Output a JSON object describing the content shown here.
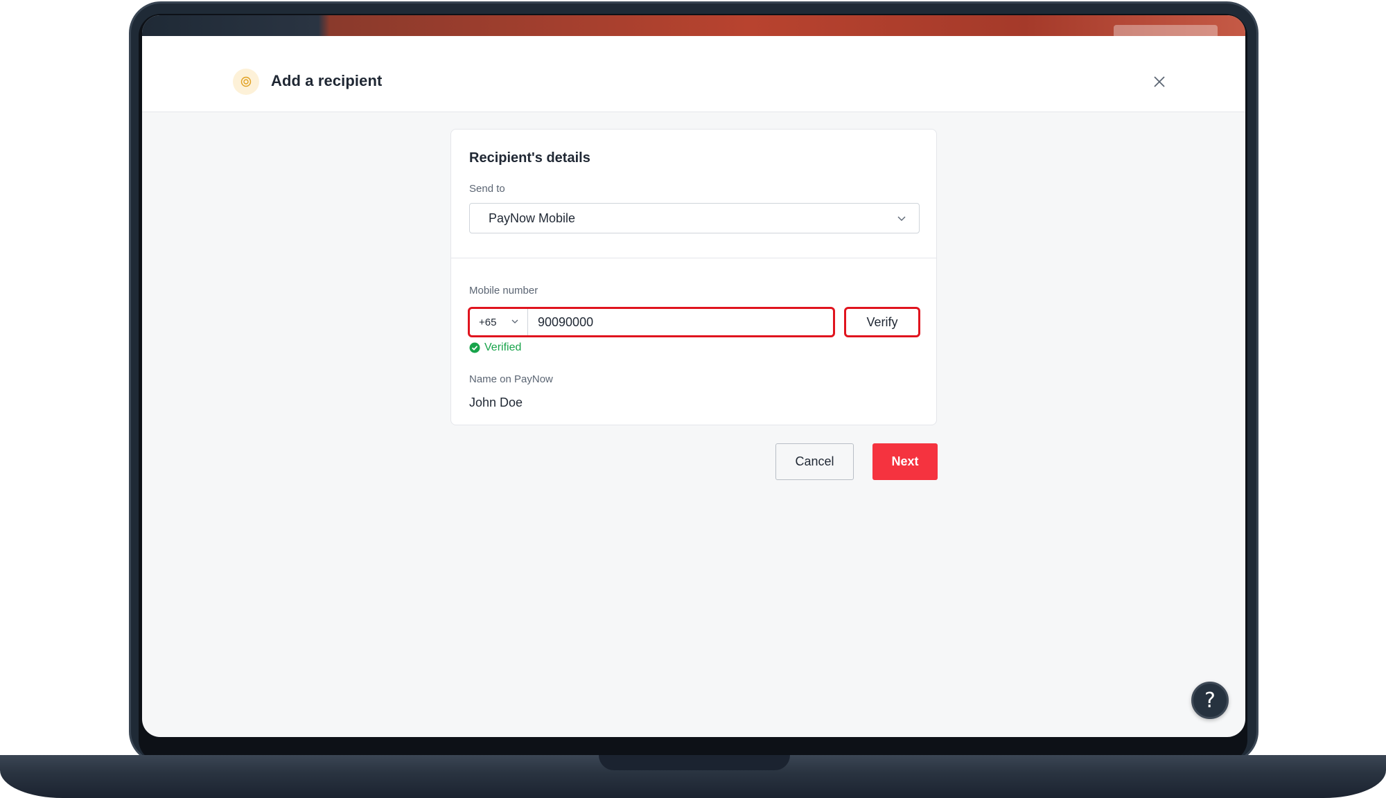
{
  "header": {
    "title": "Add a recipient"
  },
  "card": {
    "section_title": "Recipient's details",
    "send_to": {
      "label": "Send to",
      "selected": "PayNow Mobile"
    },
    "mobile": {
      "label": "Mobile number",
      "country_code": "+65",
      "value": "90090000",
      "verify_label": "Verify",
      "status": "Verified"
    },
    "name_on_paynow": {
      "label": "Name on PayNow",
      "value": "John Doe"
    }
  },
  "actions": {
    "cancel_label": "Cancel",
    "next_label": "Next"
  },
  "help": {
    "label": "?"
  },
  "colors": {
    "accent_red": "#f5333f",
    "highlight_red": "#e0141e",
    "verified_green": "#17a34a",
    "text_dark": "#1f2733"
  }
}
